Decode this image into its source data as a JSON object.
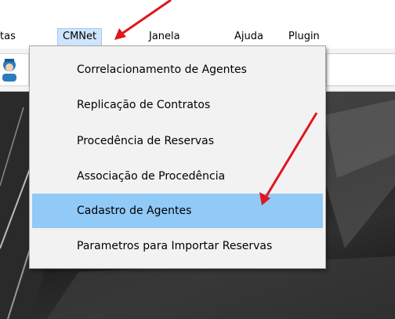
{
  "menubar": {
    "items": [
      {
        "label": "tas"
      },
      {
        "label": "CMNet"
      },
      {
        "label": "Janela"
      },
      {
        "label": "Ajuda"
      },
      {
        "label": "Plugin"
      }
    ]
  },
  "dropdown": {
    "items": [
      {
        "label": "Correlacionamento de Agentes"
      },
      {
        "label": "Replicação de Contratos"
      },
      {
        "label": "Procedência de Reservas"
      },
      {
        "label": "Associação de Procedência"
      },
      {
        "label": "Cadastro de Agentes"
      },
      {
        "label": "Parametros para Importar Reservas"
      }
    ],
    "selected_label": "Cadastro de Agentes"
  },
  "toolbar": {
    "user_icon": "user-avatar-icon"
  },
  "colors": {
    "selected_item_bg": "#91c9f7",
    "active_menu_bg": "#cfe5fb",
    "arrow": "#e0161c"
  }
}
